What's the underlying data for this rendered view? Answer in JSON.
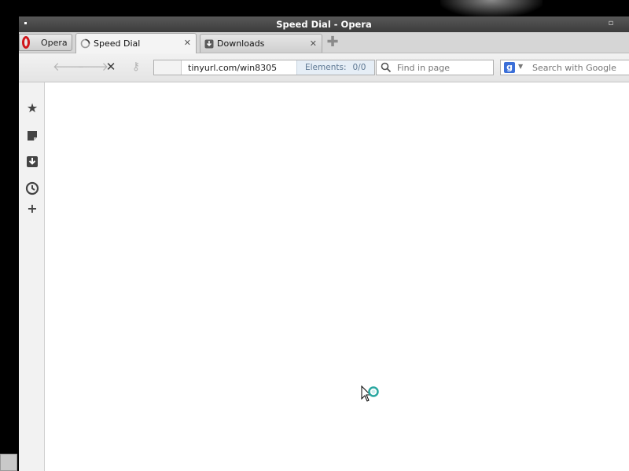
{
  "window": {
    "title": "Speed Dial - Opera"
  },
  "menu_button": {
    "label": "Opera",
    "icon": "opera-logo-icon"
  },
  "tabs": [
    {
      "label": "Speed Dial",
      "icon": "loading-spinner-icon",
      "active": true
    },
    {
      "label": "Downloads",
      "icon": "downloads-tab-icon",
      "active": false
    }
  ],
  "toolbar": {
    "address": {
      "url": "tinyurl.com/win8305",
      "elements_label": "Elements:",
      "elements_value": "0/0"
    },
    "find": {
      "placeholder": "Find in page"
    },
    "search": {
      "placeholder": "Search with Google",
      "engine_icon": "google-icon"
    }
  },
  "panel": {
    "items": [
      {
        "icon": "bookmarks-star-icon"
      },
      {
        "icon": "notes-icon"
      },
      {
        "icon": "downloads-icon"
      },
      {
        "icon": "history-clock-icon"
      },
      {
        "icon": "add-panel-icon"
      }
    ]
  },
  "colors": {
    "titlebar": "#484848",
    "opera_red": "#d0161b",
    "google_blue": "#3b6fd8",
    "elements_bg": "#e6eef6"
  }
}
